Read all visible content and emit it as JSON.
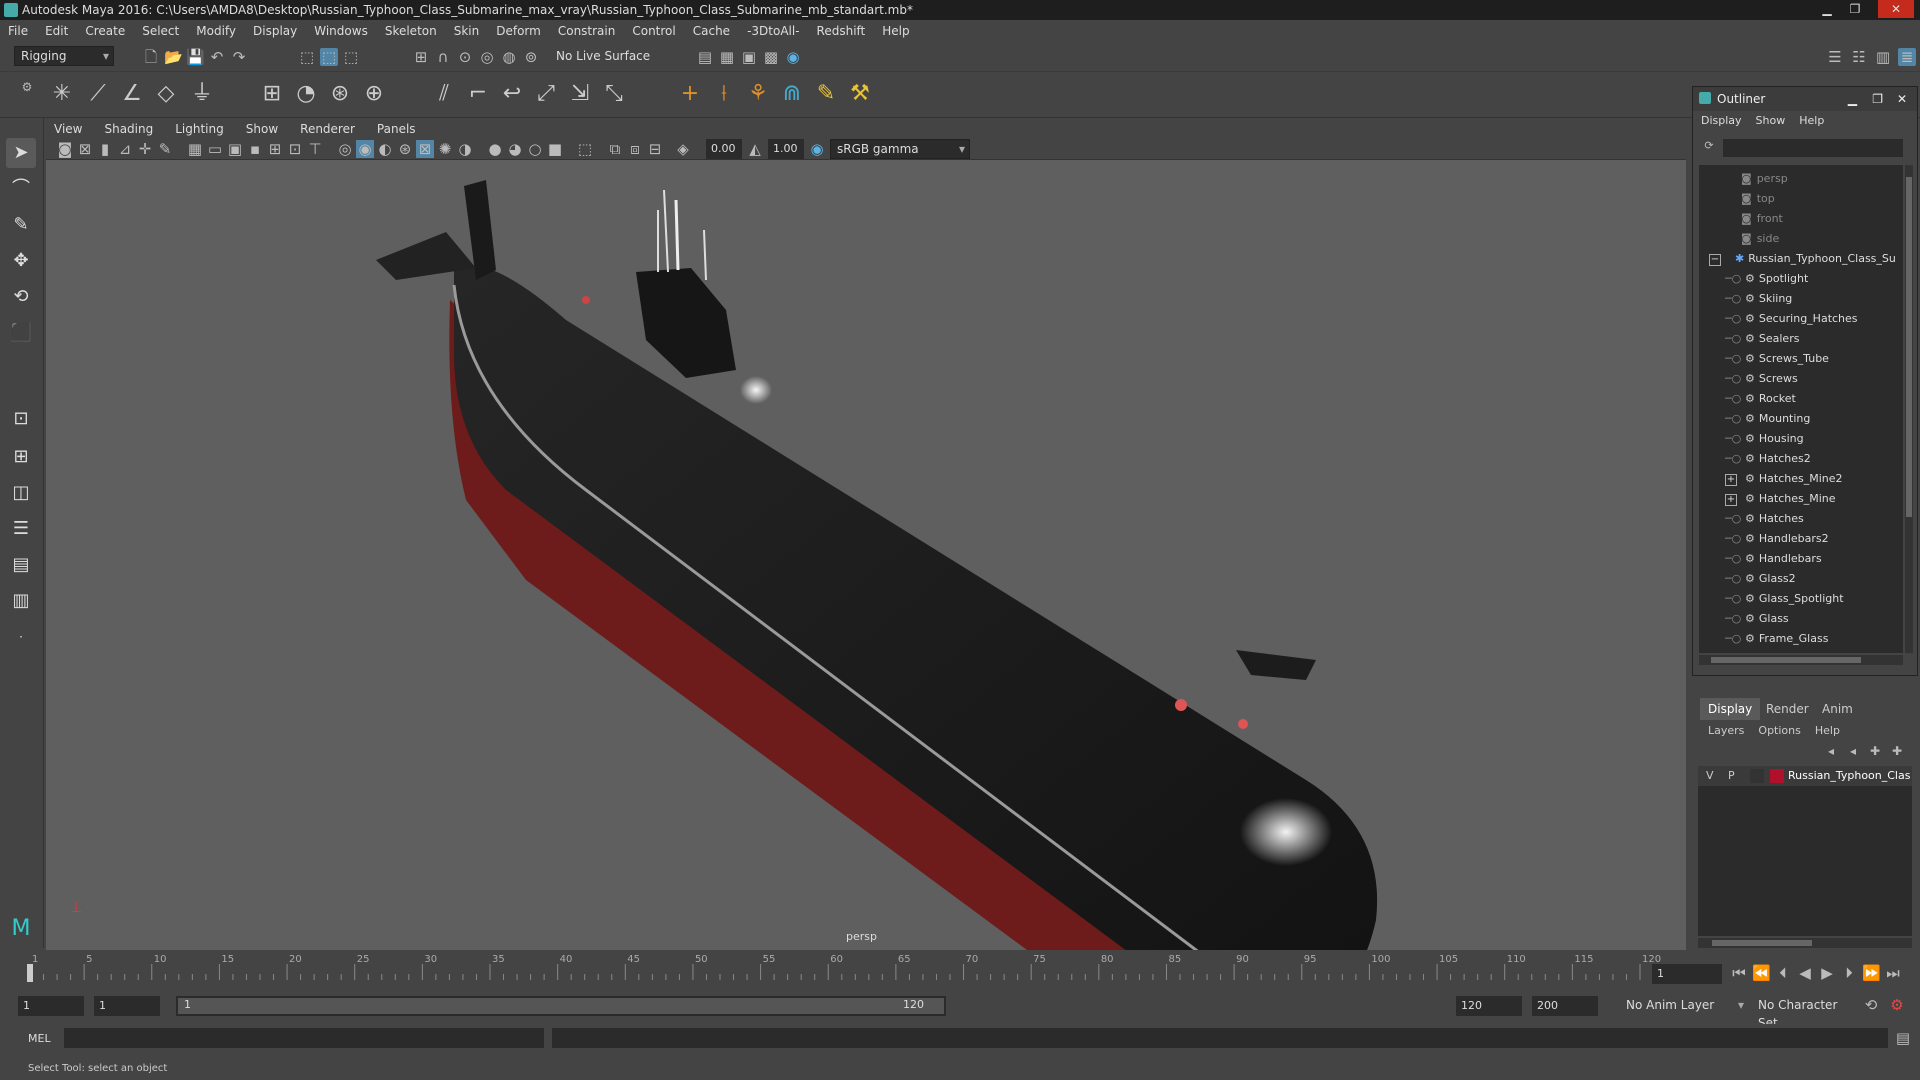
{
  "window": {
    "title": "Autodesk Maya 2016: C:\\Users\\AMDA8\\Desktop\\Russian_Typhoon_Class_Submarine_max_vray\\Russian_Typhoon_Class_Submarine_mb_standart.mb*"
  },
  "menubar": [
    "File",
    "Edit",
    "Create",
    "Select",
    "Modify",
    "Display",
    "Windows",
    "Skeleton",
    "Skin",
    "Deform",
    "Constrain",
    "Control",
    "Cache",
    "-3DtoAll-",
    "Redshift",
    "Help"
  ],
  "statusline": {
    "mode": "Rigging",
    "live_surface": "No Live Surface"
  },
  "panel": {
    "menus": [
      "View",
      "Shading",
      "Lighting",
      "Show",
      "Renderer",
      "Panels"
    ],
    "exposure": "0.00",
    "gamma": "1.00",
    "color_space": "sRGB gamma",
    "camera_label": "persp"
  },
  "outliner": {
    "title": "Outliner",
    "menus": [
      "Display",
      "Show",
      "Help"
    ],
    "cameras": [
      "persp",
      "top",
      "front",
      "side"
    ],
    "root": "Russian_Typhoon_Class_Su",
    "children": [
      {
        "name": "Spotlight",
        "expand": false
      },
      {
        "name": "Skiing",
        "expand": false
      },
      {
        "name": "Securing_Hatches",
        "expand": false
      },
      {
        "name": "Sealers",
        "expand": false
      },
      {
        "name": "Screws_Tube",
        "expand": false
      },
      {
        "name": "Screws",
        "expand": false
      },
      {
        "name": "Rocket",
        "expand": false
      },
      {
        "name": "Mounting",
        "expand": false
      },
      {
        "name": "Housing",
        "expand": false
      },
      {
        "name": "Hatches2",
        "expand": false
      },
      {
        "name": "Hatches_Mine2",
        "expand": true
      },
      {
        "name": "Hatches_Mine",
        "expand": true
      },
      {
        "name": "Hatches",
        "expand": false
      },
      {
        "name": "Handlebars2",
        "expand": false
      },
      {
        "name": "Handlebars",
        "expand": false
      },
      {
        "name": "Glass2",
        "expand": false
      },
      {
        "name": "Glass_Spotlight",
        "expand": false
      },
      {
        "name": "Glass",
        "expand": false
      },
      {
        "name": "Frame_Glass",
        "expand": false
      }
    ]
  },
  "layers": {
    "tabs": [
      "Display",
      "Render",
      "Anim"
    ],
    "menus": [
      "Layers",
      "Options",
      "Help"
    ],
    "row": {
      "v": "V",
      "p": "P",
      "name": "Russian_Typhoon_Clas",
      "color": "#b0102a"
    }
  },
  "timeline": {
    "ticks": [
      "1",
      "5",
      "10",
      "15",
      "20",
      "25",
      "30",
      "35",
      "40",
      "45",
      "50",
      "55",
      "60",
      "65",
      "70",
      "75",
      "80",
      "85",
      "90",
      "95",
      "100",
      "105",
      "110",
      "115",
      "120"
    ],
    "current_frame": "1"
  },
  "range": {
    "start": "1",
    "anim_start": "1",
    "slider_start": "1",
    "slider_end": "120",
    "anim_end": "120",
    "end": "200",
    "anim_layer": "No Anim Layer",
    "character_set": "No Character Set"
  },
  "cmdline": {
    "lang": "MEL"
  },
  "help_line": "Select Tool: select an object",
  "colors": {
    "hull_top": "#1a1a1a",
    "hull_bottom": "#7a1e1e",
    "viewport_bg": "#5f5f5f",
    "accent": "#5285a6"
  }
}
